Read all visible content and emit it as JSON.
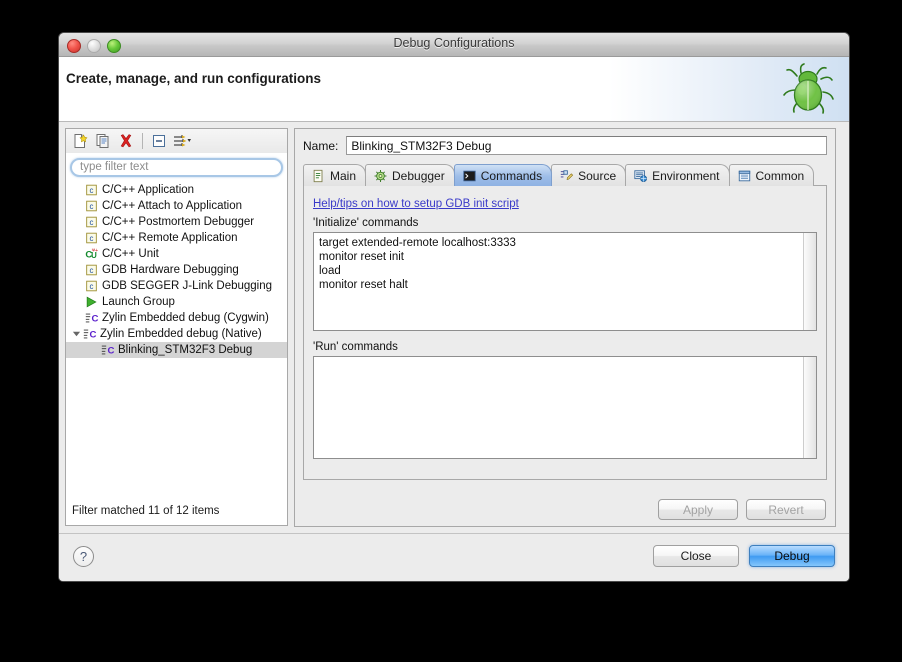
{
  "window": {
    "title": "Debug Configurations",
    "traffic_lights": [
      "close-button",
      "minimize-button",
      "zoom-button"
    ]
  },
  "header": {
    "title": "Create, manage, and run configurations",
    "icon": "green-bug-icon"
  },
  "tree_toolbar": {
    "buttons": [
      {
        "name": "new-configuration-button",
        "icon": "new-document-icon"
      },
      {
        "name": "duplicate-configuration-button",
        "icon": "copy-icon"
      },
      {
        "name": "delete-configuration-button",
        "icon": "red-x-icon"
      },
      {
        "name": "collapse-all-button",
        "icon": "collapse-all-icon"
      },
      {
        "name": "filter-menu-button",
        "icon": "filter-arrows-icon"
      }
    ]
  },
  "filter": {
    "placeholder": "type filter text",
    "value": ""
  },
  "tree": {
    "items": [
      {
        "label": "C/C++ Application",
        "icon": "c-file-icon",
        "indent": 1,
        "selected": false,
        "arrow": ""
      },
      {
        "label": "C/C++ Attach to Application",
        "icon": "c-file-icon",
        "indent": 1,
        "selected": false,
        "arrow": ""
      },
      {
        "label": "C/C++ Postmortem Debugger",
        "icon": "c-file-icon",
        "indent": 1,
        "selected": false,
        "arrow": ""
      },
      {
        "label": "C/C++ Remote Application",
        "icon": "c-file-icon",
        "indent": 1,
        "selected": false,
        "arrow": ""
      },
      {
        "label": "C/C++ Unit",
        "icon": "cpp-unit-icon",
        "indent": 1,
        "selected": false,
        "arrow": ""
      },
      {
        "label": "GDB Hardware Debugging",
        "icon": "c-file-icon",
        "indent": 1,
        "selected": false,
        "arrow": ""
      },
      {
        "label": "GDB SEGGER J-Link Debugging",
        "icon": "c-file-icon",
        "indent": 1,
        "selected": false,
        "arrow": ""
      },
      {
        "label": "Launch Group",
        "icon": "green-play-icon",
        "indent": 1,
        "selected": false,
        "arrow": ""
      },
      {
        "label": "Zylin Embedded debug (Cygwin)",
        "icon": "zylin-debug-icon",
        "indent": 1,
        "selected": false,
        "arrow": ""
      },
      {
        "label": "Zylin Embedded debug (Native)",
        "icon": "zylin-debug-icon",
        "indent": 1,
        "selected": false,
        "arrow": "expanded"
      },
      {
        "label": "Blinking_STM32F3 Debug",
        "icon": "zylin-debug-icon",
        "indent": 2,
        "selected": true,
        "arrow": ""
      }
    ],
    "status": "Filter matched 11 of 12 items"
  },
  "config": {
    "name_label": "Name:",
    "name_value": "Blinking_STM32F3 Debug"
  },
  "tabs": [
    {
      "label": "Main",
      "icon": "document-icon",
      "active": false
    },
    {
      "label": "Debugger",
      "icon": "bug-gear-icon",
      "active": false
    },
    {
      "label": "Commands",
      "icon": "console-icon",
      "active": true
    },
    {
      "label": "Source",
      "icon": "source-edit-icon",
      "active": false
    },
    {
      "label": "Environment",
      "icon": "environment-icon",
      "active": false
    },
    {
      "label": "Common",
      "icon": "common-list-icon",
      "active": false
    }
  ],
  "commands_tab": {
    "help_link": "Help/tips on how to setup GDB init script",
    "initialize_label": "'Initialize' commands",
    "initialize_value": "target extended-remote localhost:3333\nmonitor reset init\nload\nmonitor reset halt",
    "run_label": "'Run' commands",
    "run_value": ""
  },
  "apply_bar": {
    "apply_label": "Apply",
    "apply_enabled": false,
    "revert_label": "Revert",
    "revert_enabled": false
  },
  "footer": {
    "help_glyph": "?",
    "close_label": "Close",
    "debug_label": "Debug"
  },
  "colors": {
    "window_bg": "#ececec",
    "selected_tab": "#9dbde8",
    "link": "#3a3ac9",
    "default_button": "#3f9bf2",
    "selection_row": "#d4d4d4",
    "bug_green": "#5cb033"
  }
}
